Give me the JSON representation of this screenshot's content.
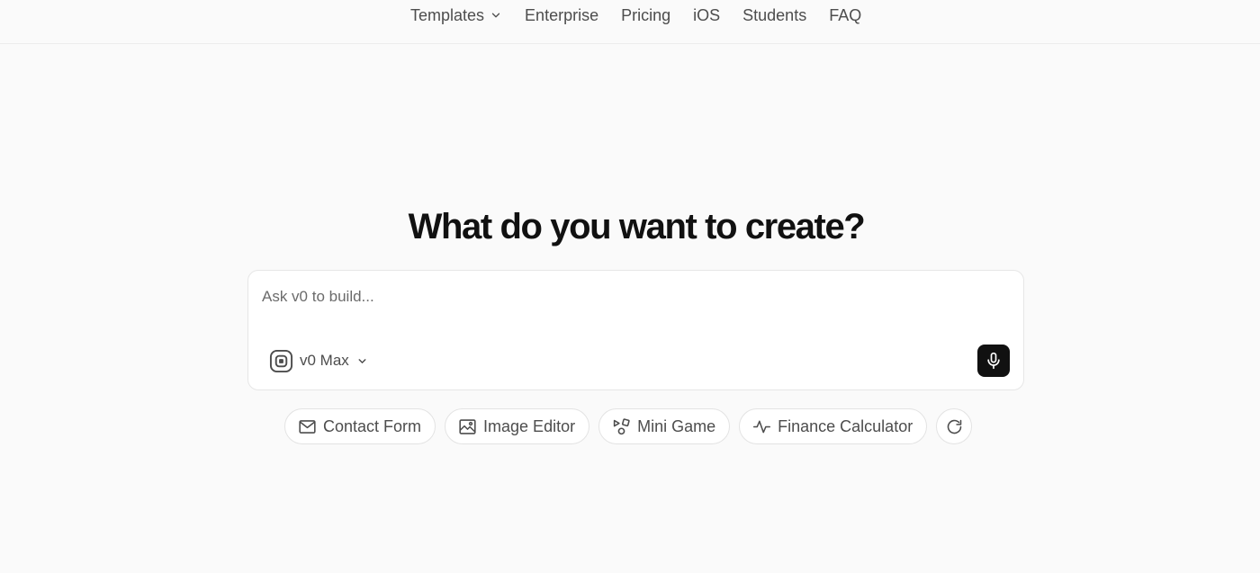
{
  "nav": {
    "items": [
      {
        "label": "Templates",
        "has_dropdown": true
      },
      {
        "label": "Enterprise"
      },
      {
        "label": "Pricing"
      },
      {
        "label": "iOS"
      },
      {
        "label": "Students"
      },
      {
        "label": "FAQ"
      }
    ]
  },
  "hero": {
    "title": "What do you want to create?"
  },
  "prompt": {
    "placeholder": "Ask v0 to build...",
    "value": "",
    "model": {
      "label": "v0 Max",
      "icon": "model-chip-icon"
    },
    "mic_icon": "microphone-icon"
  },
  "suggestions": {
    "chips": [
      {
        "label": "Contact Form",
        "icon": "mail-icon"
      },
      {
        "label": "Image Editor",
        "icon": "image-icon"
      },
      {
        "label": "Mini Game",
        "icon": "shapes-icon"
      },
      {
        "label": "Finance Calculator",
        "icon": "activity-icon"
      }
    ],
    "refresh_icon": "refresh-icon"
  },
  "colors": {
    "background": "#fafafa",
    "text_primary": "#111111",
    "text_secondary": "#4d4d4d",
    "mic_button": "#111111",
    "border": "#e3e3e3"
  }
}
